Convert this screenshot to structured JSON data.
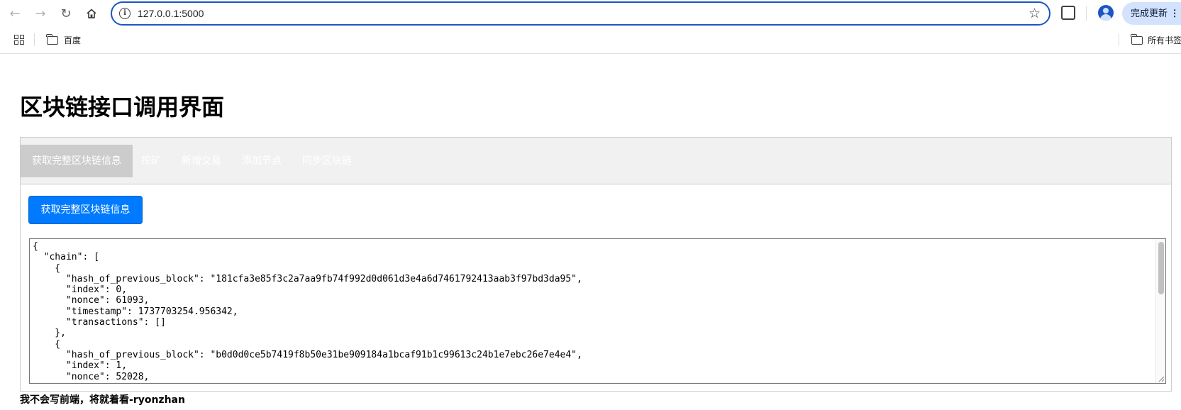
{
  "browser": {
    "url": "127.0.0.1:5000",
    "update_button": "完成更新",
    "nav_icons": [
      "back-arrow-icon",
      "forward-arrow-icon",
      "reload-icon",
      "home-icon"
    ],
    "bookmarks": [
      {
        "label": "百度",
        "icon": "folder-icon"
      }
    ],
    "all_bookmarks": "所有书签",
    "accent_color": "#1a56c5"
  },
  "page": {
    "title": "区块链接口调用界面",
    "tabs": [
      {
        "label": "获取完整区块链信息",
        "active": true
      },
      {
        "label": "挖矿",
        "active": false
      },
      {
        "label": "新增交易",
        "active": false
      },
      {
        "label": "添加节点",
        "active": false
      },
      {
        "label": "同步区块链",
        "active": false
      }
    ],
    "action_button": "获取完整区块链信息",
    "action_button_color": "#007bff",
    "output_text": "{\n  \"chain\": [\n    {\n      \"hash_of_previous_block\": \"181cfa3e85f3c2a7aa9fb74f992d0d061d3e4a6d7461792413aab3f97bd3da95\",\n      \"index\": 0,\n      \"nonce\": 61093,\n      \"timestamp\": 1737703254.956342,\n      \"transactions\": []\n    },\n    {\n      \"hash_of_previous_block\": \"b0d0d0ce5b7419f8b50e31be909184a1bcaf91b1c99613c24b1e7ebc26e7e4e4\",\n      \"index\": 1,\n      \"nonce\": 52028,",
    "footer": "我不会写前端，将就着看-ryonzhan"
  }
}
